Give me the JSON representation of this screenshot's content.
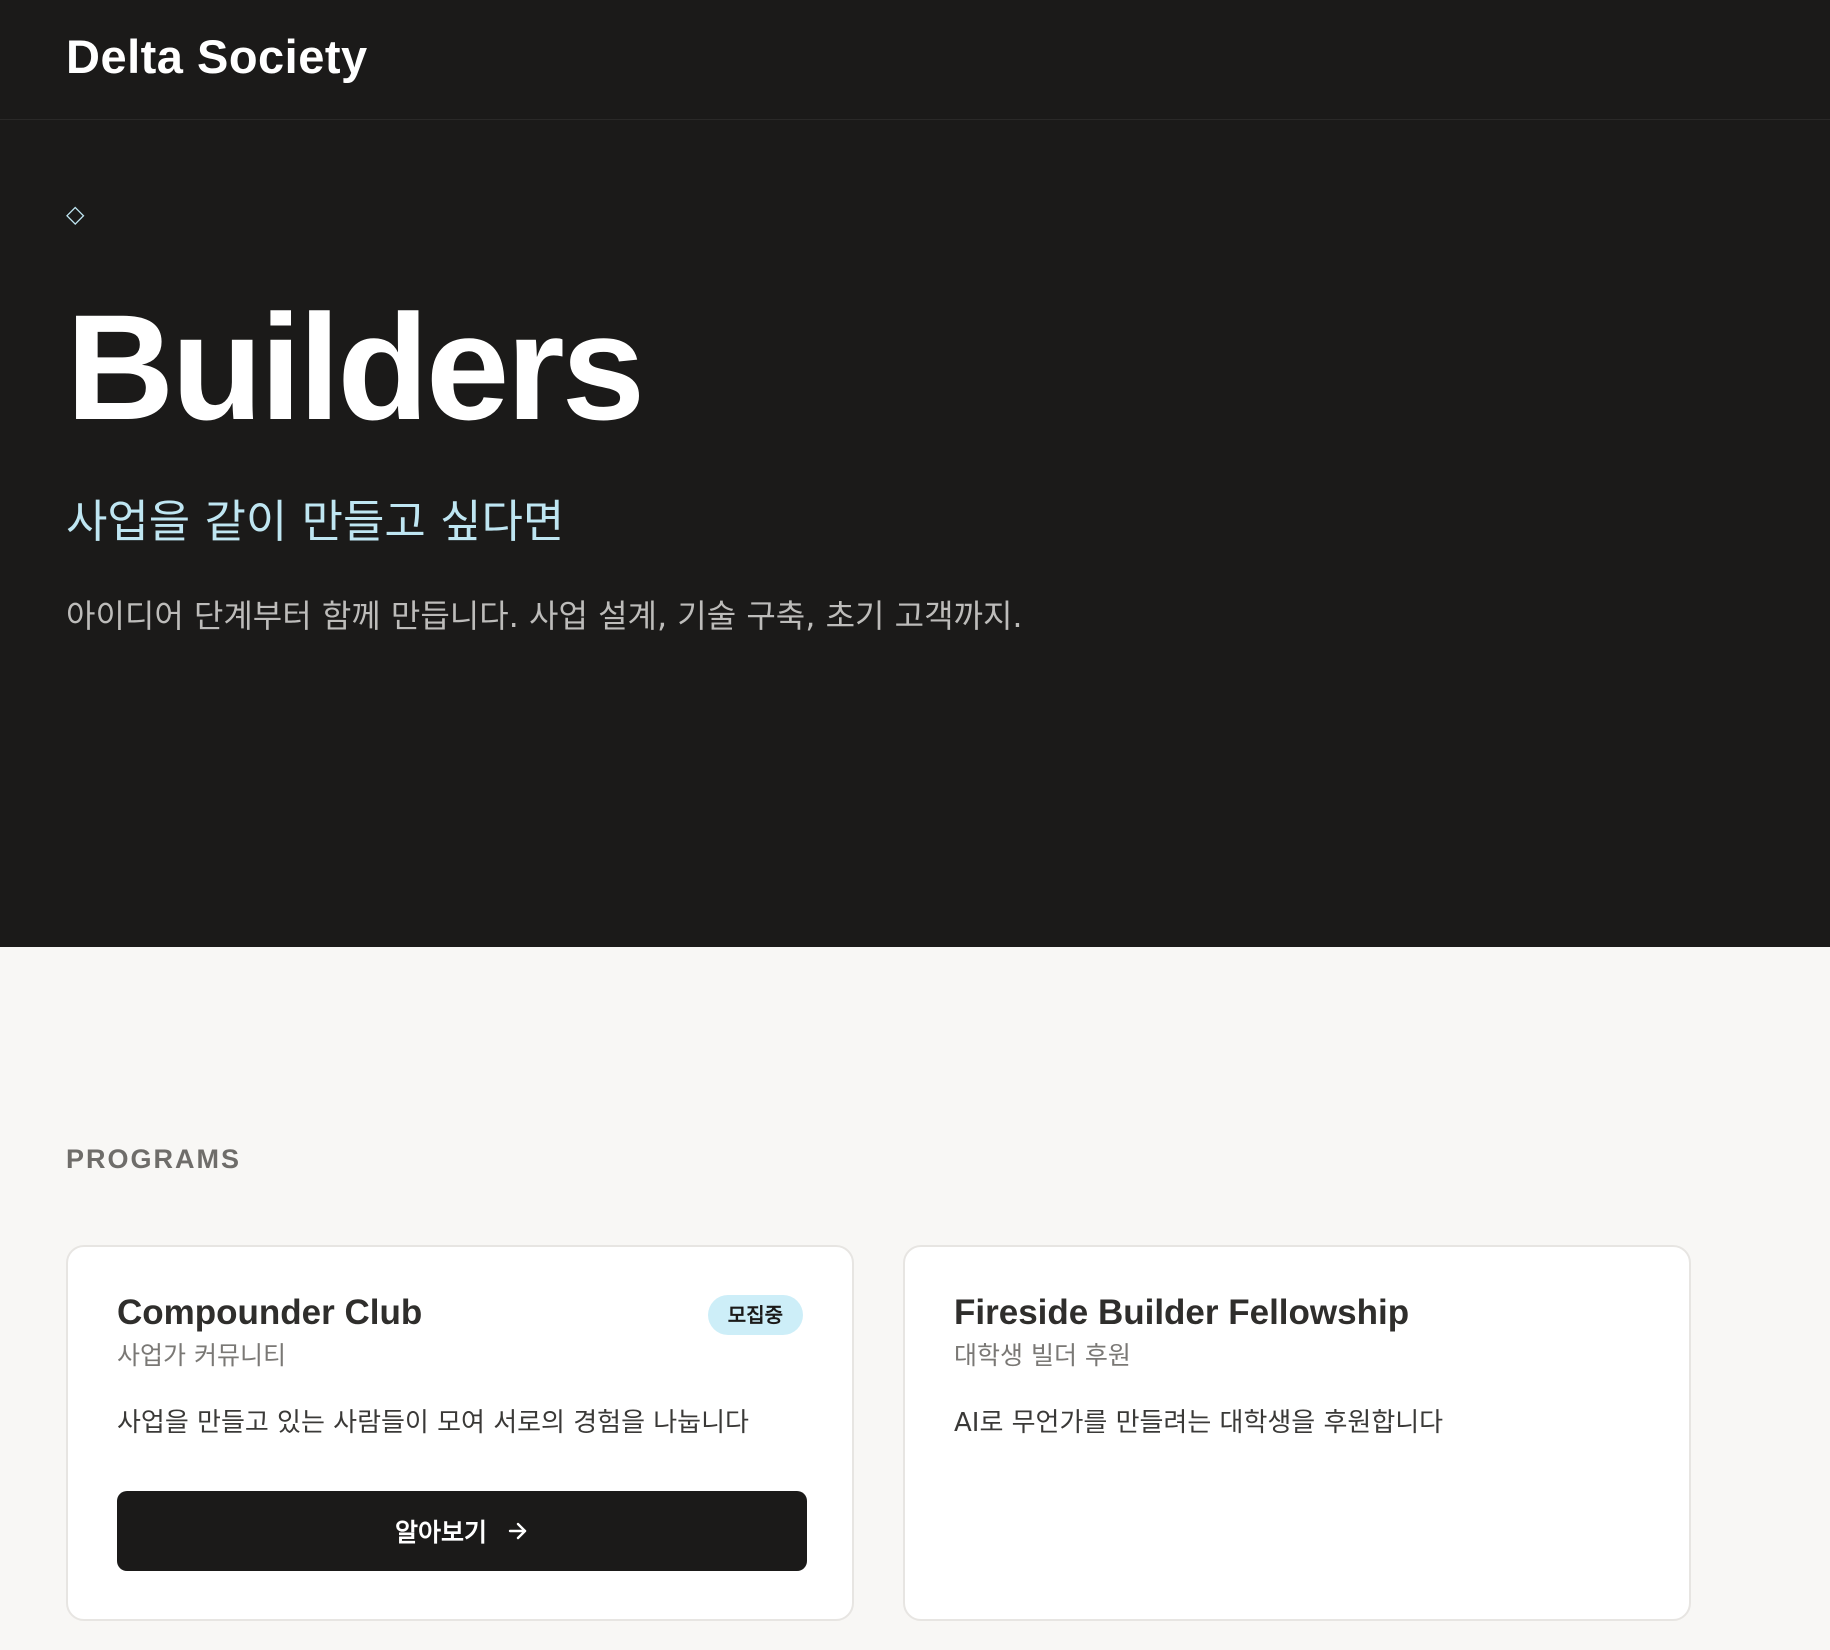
{
  "header": {
    "logo_text": "Delta Society"
  },
  "hero": {
    "icon": "diamond-icon",
    "icon_glyph": "◇",
    "title": "Builders",
    "subtitle": "사업을 같이 만들고 싶다면",
    "description": "아이디어 단계부터 함께 만듭니다. 사업 설계, 기술 구축, 초기 고객까지."
  },
  "programs": {
    "section_label": "PROGRAMS",
    "cards": [
      {
        "title": "Compounder Club",
        "subtitle": "사업가 커뮤니티",
        "badge": "모집중",
        "description": "사업을 만들고 있는 사람들이 모여 서로의 경험을 나눕니다",
        "button_label": "알아보기",
        "button_icon": "arrow-right-icon"
      },
      {
        "title": "Fireside Builder Fellowship",
        "subtitle": "대학생 빌더 후원",
        "description": "AI로 무언가를 만들려는 대학생을 후원합니다"
      }
    ]
  },
  "colors": {
    "hero_background": "#1b1a19",
    "page_background": "#f8f7f5",
    "accent_cyan": "#bfe6f2",
    "badge_background": "#cdeef8",
    "button_background": "#1b1a19"
  }
}
